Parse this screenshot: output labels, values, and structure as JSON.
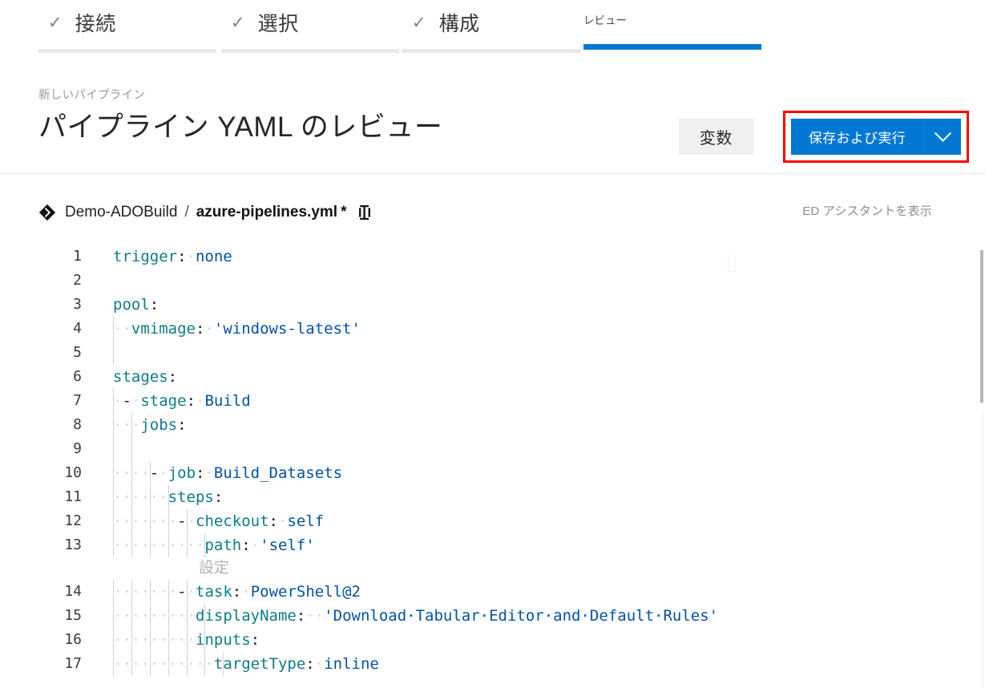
{
  "wizard": {
    "tabs": [
      {
        "label": "接続",
        "state": "done",
        "check": "✓"
      },
      {
        "label": "選択",
        "state": "done",
        "check": "✓"
      },
      {
        "label": "構成",
        "state": "done",
        "check": "✓"
      },
      {
        "label": "レビュー",
        "state": "active",
        "check": ""
      }
    ]
  },
  "header": {
    "breadcrumb": "新しいパイプライン",
    "title": "パイプライン YAML のレビュー",
    "variables_label": "変数",
    "save_run_label": "保存および実行",
    "save_run_caret_icon": "chevron-down-icon",
    "highlight_color": "#ff0000",
    "accent_color": "#0078d4"
  },
  "file_bar": {
    "repo_icon": "azure-repos-icon",
    "repo_name": "Demo-ADOBuild",
    "separator": "/",
    "file_name": "azure-pipelines.yml",
    "dirty_marker": "*",
    "branch_icon": "branch-icon",
    "assistant_link": "ED アシスタントを表示"
  },
  "editor": {
    "codelens": {
      "label": "設定",
      "after_line": 13
    },
    "scrollbar": {
      "visible": true
    },
    "lines": [
      {
        "n": 1,
        "indents": 0,
        "tokens": [
          {
            "t": "key",
            "v": "trigger"
          },
          {
            "t": "punct",
            "v": ":"
          },
          {
            "t": "ws",
            "v": "·"
          },
          {
            "t": "val",
            "v": "none"
          }
        ]
      },
      {
        "n": 2,
        "indents": 0,
        "tokens": []
      },
      {
        "n": 3,
        "indents": 0,
        "tokens": [
          {
            "t": "key",
            "v": "pool"
          },
          {
            "t": "punct",
            "v": ":"
          }
        ]
      },
      {
        "n": 4,
        "indents": 1,
        "tokens": [
          {
            "t": "ws",
            "v": "··"
          },
          {
            "t": "key",
            "v": "vmimage"
          },
          {
            "t": "punct",
            "v": ":"
          },
          {
            "t": "ws",
            "v": "·"
          },
          {
            "t": "str",
            "v": "'windows-latest'"
          }
        ]
      },
      {
        "n": 5,
        "indents": 1,
        "tokens": []
      },
      {
        "n": 6,
        "indents": 0,
        "tokens": [
          {
            "t": "key",
            "v": "stages"
          },
          {
            "t": "punct",
            "v": ":"
          }
        ]
      },
      {
        "n": 7,
        "indents": 1,
        "tokens": [
          {
            "t": "ws",
            "v": "·"
          },
          {
            "t": "dash",
            "v": "-"
          },
          {
            "t": "ws",
            "v": "·"
          },
          {
            "t": "key",
            "v": "stage"
          },
          {
            "t": "punct",
            "v": ":"
          },
          {
            "t": "ws",
            "v": "·"
          },
          {
            "t": "val",
            "v": "Build"
          }
        ]
      },
      {
        "n": 8,
        "indents": 2,
        "tokens": [
          {
            "t": "ws",
            "v": "··"
          },
          {
            "t": "ws",
            "v": "·"
          },
          {
            "t": "key",
            "v": "jobs"
          },
          {
            "t": "punct",
            "v": ":"
          }
        ]
      },
      {
        "n": 9,
        "indents": 2,
        "tokens": []
      },
      {
        "n": 10,
        "indents": 3,
        "tokens": [
          {
            "t": "ws",
            "v": "··"
          },
          {
            "t": "ws",
            "v": "··"
          },
          {
            "t": "dash",
            "v": "-"
          },
          {
            "t": "ws",
            "v": "·"
          },
          {
            "t": "key",
            "v": "job"
          },
          {
            "t": "punct",
            "v": ":"
          },
          {
            "t": "ws",
            "v": "·"
          },
          {
            "t": "val",
            "v": "Build_Datasets"
          }
        ]
      },
      {
        "n": 11,
        "indents": 4,
        "tokens": [
          {
            "t": "ws",
            "v": "··"
          },
          {
            "t": "ws",
            "v": "··"
          },
          {
            "t": "ws",
            "v": "··"
          },
          {
            "t": "key",
            "v": "steps"
          },
          {
            "t": "punct",
            "v": ":"
          }
        ]
      },
      {
        "n": 12,
        "indents": 5,
        "tokens": [
          {
            "t": "ws",
            "v": "··"
          },
          {
            "t": "ws",
            "v": "··"
          },
          {
            "t": "ws",
            "v": "··"
          },
          {
            "t": "ws",
            "v": "·"
          },
          {
            "t": "dash",
            "v": "-"
          },
          {
            "t": "ws",
            "v": "·"
          },
          {
            "t": "key",
            "v": "checkout"
          },
          {
            "t": "punct",
            "v": ":"
          },
          {
            "t": "ws",
            "v": "·"
          },
          {
            "t": "val",
            "v": "self"
          }
        ]
      },
      {
        "n": 13,
        "indents": 6,
        "tokens": [
          {
            "t": "ws",
            "v": "··"
          },
          {
            "t": "ws",
            "v": "··"
          },
          {
            "t": "ws",
            "v": "··"
          },
          {
            "t": "ws",
            "v": "··"
          },
          {
            "t": "ws",
            "v": "··"
          },
          {
            "t": "key",
            "v": "path"
          },
          {
            "t": "punct",
            "v": ":"
          },
          {
            "t": "ws",
            "v": "·"
          },
          {
            "t": "str",
            "v": "'self'"
          }
        ]
      },
      {
        "n": 14,
        "indents": 5,
        "tokens": [
          {
            "t": "ws",
            "v": "··"
          },
          {
            "t": "ws",
            "v": "··"
          },
          {
            "t": "ws",
            "v": "··"
          },
          {
            "t": "ws",
            "v": "·"
          },
          {
            "t": "dash",
            "v": "-"
          },
          {
            "t": "ws",
            "v": "·"
          },
          {
            "t": "key",
            "v": "task"
          },
          {
            "t": "punct",
            "v": ":"
          },
          {
            "t": "ws",
            "v": "·"
          },
          {
            "t": "val",
            "v": "PowerShell@2"
          }
        ]
      },
      {
        "n": 15,
        "indents": 6,
        "tokens": [
          {
            "t": "ws",
            "v": "··"
          },
          {
            "t": "ws",
            "v": "··"
          },
          {
            "t": "ws",
            "v": "··"
          },
          {
            "t": "ws",
            "v": "··"
          },
          {
            "t": "ws",
            "v": "·"
          },
          {
            "t": "key",
            "v": "displayName"
          },
          {
            "t": "punct",
            "v": ":"
          },
          {
            "t": "ws",
            "v": "··"
          },
          {
            "t": "str",
            "v": "'Download·Tabular·Editor·and·Default·Rules'"
          }
        ]
      },
      {
        "n": 16,
        "indents": 6,
        "tokens": [
          {
            "t": "ws",
            "v": "··"
          },
          {
            "t": "ws",
            "v": "··"
          },
          {
            "t": "ws",
            "v": "··"
          },
          {
            "t": "ws",
            "v": "··"
          },
          {
            "t": "ws",
            "v": "·"
          },
          {
            "t": "key",
            "v": "inputs"
          },
          {
            "t": "punct",
            "v": ":"
          }
        ]
      },
      {
        "n": 17,
        "indents": 7,
        "tokens": [
          {
            "t": "ws",
            "v": "··"
          },
          {
            "t": "ws",
            "v": "··"
          },
          {
            "t": "ws",
            "v": "··"
          },
          {
            "t": "ws",
            "v": "··"
          },
          {
            "t": "ws",
            "v": "··"
          },
          {
            "t": "ws",
            "v": "·"
          },
          {
            "t": "key",
            "v": "targetType"
          },
          {
            "t": "punct",
            "v": ":"
          },
          {
            "t": "ws",
            "v": "·"
          },
          {
            "t": "val",
            "v": "inline"
          }
        ]
      }
    ]
  }
}
